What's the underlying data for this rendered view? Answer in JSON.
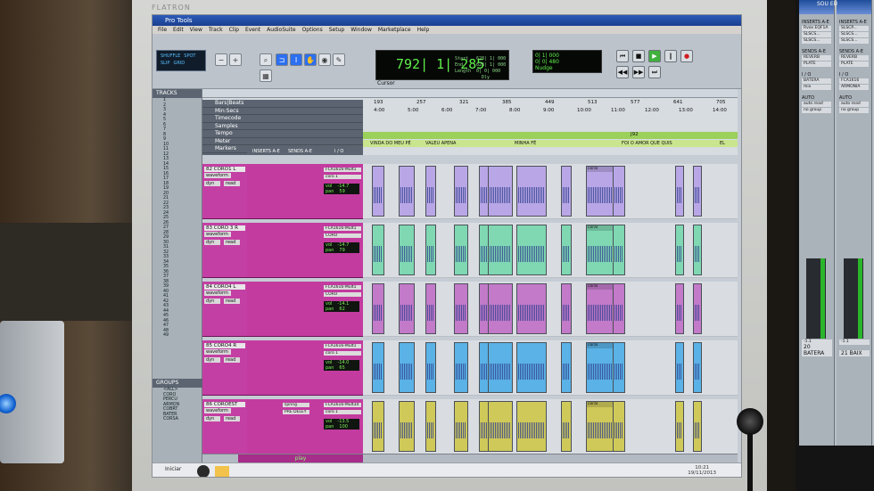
{
  "app": {
    "monitor_brand": "FLATRON",
    "title": "Pro Tools",
    "menu": [
      "File",
      "Edit",
      "View",
      "Track",
      "Clip",
      "Event",
      "AudioSuite",
      "Options",
      "Setup",
      "Window",
      "Marketplace",
      "Help"
    ]
  },
  "transport": {
    "modes": [
      "SHUFFLE",
      "SPOT",
      "SLIP",
      "GRID"
    ],
    "counter_main": "792| 1| 285",
    "cursor_label": "Cursor",
    "start_label": "Start",
    "end_label": "End",
    "length_label": "Length",
    "start_value": "628| 1| 000",
    "end_value": "628| 1| 000",
    "length_value": "0| 0| 000",
    "nudge_label": "Nudge",
    "nudge_value": "0| 0| 480",
    "grid_value": "0| 1| 000",
    "dly_label": "Dly"
  },
  "sidebar": {
    "tracks_header": "TRACKS",
    "groups_header": "GROUPS",
    "track_numbers": [
      "1",
      "2",
      "3",
      "4",
      "5",
      "6",
      "7",
      "8",
      "9",
      "10",
      "11",
      "12",
      "13",
      "14",
      "15",
      "16",
      "17",
      "18",
      "19",
      "20",
      "21",
      "22",
      "23",
      "24",
      "25",
      "26",
      "27",
      "28",
      "29",
      "30",
      "31",
      "32",
      "33",
      "34",
      "35",
      "36",
      "37",
      "38",
      "39",
      "40",
      "41",
      "42",
      "43",
      "44",
      "45",
      "46",
      "47",
      "48",
      "49"
    ],
    "groups": [
      "<ALL>",
      "CORO",
      "PERCU",
      "ARMON",
      "COBRT",
      "BATER",
      "CORSA"
    ]
  },
  "rulers": {
    "labels": [
      "Bars|Beats",
      "Min:Secs",
      "Timecode",
      "Samples",
      "Tempo",
      "Meter",
      "Markers"
    ],
    "bars": [
      "193",
      "257",
      "321",
      "385",
      "449",
      "513",
      "577",
      "641",
      "705"
    ],
    "minsecs": [
      "4:00",
      "5:00",
      "6:00",
      "7:00",
      "8:00",
      "9:00",
      "10:00",
      "11:00",
      "12:00",
      "13:00",
      "14:00"
    ],
    "markers": [
      "VINDA DO MEU PÉ",
      "VALEU APENA",
      "MINHA FÉ",
      "FOI O AMOR QUE QUIS",
      "EL"
    ],
    "tempo_value": "J92"
  },
  "track_columns": {
    "inserts_header": "INSERTS A-E",
    "sends_header": "SENDS A-E",
    "io_header": "I / O"
  },
  "tracks": [
    {
      "name": "82 CORO1 L",
      "plugin": "FCA1616-Mult1",
      "bus": "coro 1",
      "vol": "-14.7",
      "pan": "59",
      "color": "#b9a6e6",
      "clip": "coral"
    },
    {
      "name": "83 CORO 3 R",
      "plugin": "FCA1616-Mult1",
      "bus": "CORO",
      "vol": "-14.7",
      "pan": "79",
      "color": "#7fd8b2",
      "clip": "coral"
    },
    {
      "name": "84 CORO4 L",
      "plugin": "FCA1616-Mult1",
      "bus": "CORO",
      "vol": "-14.1",
      "pan": "62",
      "color": "#c27ac9",
      "clip": "coral"
    },
    {
      "name": "85 CORO4 R",
      "plugin": "FCA1616-Mult1",
      "bus": "coro 1",
      "vol": "-14.0",
      "pan": "65",
      "color": "#5ab2e6",
      "clip": "coral"
    },
    {
      "name": "86 COROEST",
      "plugin": "FCA1616-Mult34",
      "bus": "coro 1",
      "vol": "-13.5",
      "pan": "100",
      "color": "#cfc95a",
      "clip": "coral",
      "insert": "spring",
      "send": "PRE DELEY"
    }
  ],
  "track_controls": {
    "waveform": "waveform",
    "dyn": "dyn",
    "read": "read",
    "vol": "vol",
    "pan": "pan"
  },
  "bottom": {
    "scroll_label": "play"
  },
  "taskbar": {
    "start": "Iniciar",
    "time": "10:21",
    "date": "19/11/2013"
  },
  "right_mixer": {
    "title": "SOU EU",
    "columns": [
      {
        "inserts_header": "INSERTS A-E",
        "inserts": [
          "Rvox EQF1A",
          "SLSCS...",
          "SLSCS..."
        ],
        "sends_header": "SENDS A-E",
        "sends": [
          "REVERB",
          "PLATE"
        ],
        "io_header": "I / O",
        "io": [
          "BATERA",
          "mix"
        ],
        "auto_header": "AUTO",
        "auto": "auto read",
        "group": "no group",
        "vol": "-1.1",
        "name": "20 BATERA"
      },
      {
        "inserts_header": "INSERTS A-E",
        "inserts": [
          "SLSCP...",
          "SLSCS...",
          "SLSCS..."
        ],
        "sends_header": "SENDS A-E",
        "sends": [
          "REVERB",
          "PLATE"
        ],
        "io_header": "I / O",
        "io": [
          "FCA1616",
          "ARMONIA"
        ],
        "auto_header": "AUTO",
        "auto": "auto read",
        "group": "no group",
        "vol": "-1.1",
        "name": "21 BAIX"
      }
    ]
  }
}
